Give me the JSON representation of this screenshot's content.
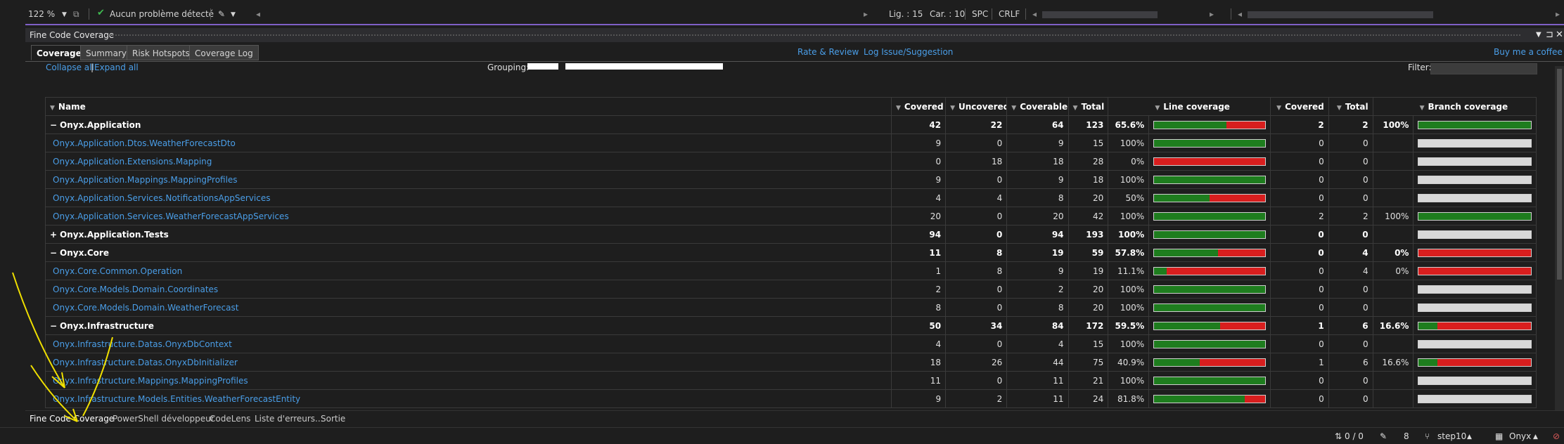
{
  "colors": {
    "accent": "#7f5fc6",
    "link": "#4a9ee8",
    "covered": "#1e7d1e",
    "uncovered": "#d81e1e",
    "no_branch": "#d8d8d8",
    "annotation": "#f0e000"
  },
  "editor_status": {
    "zoom": "122 %",
    "issues": "Aucun problème détecté",
    "line": "Lig. : 15",
    "column": "Car. : 10",
    "spacing": "SPC",
    "line_ending": "CRLF"
  },
  "panel": {
    "title": "Fine Code Coverage",
    "tabs": [
      "Coverage",
      "Summary",
      "Risk Hotspots",
      "Coverage Log"
    ],
    "links": {
      "rate": "Rate & Review",
      "issue": "Log Issue/Suggestion",
      "coffee": "Buy me a coffee"
    },
    "collapse_all": "Collapse all",
    "separator": "|",
    "expand_all": "Expand all",
    "grouping_label": "Grouping:",
    "filter_label": "Filter:"
  },
  "grid": {
    "headers": [
      "Name",
      "Covered",
      "Uncovered",
      "Coverable",
      "Total",
      "Line coverage",
      "Covered",
      "Total",
      "Branch coverage"
    ],
    "rows": [
      {
        "toggle": "−",
        "name": "Onyx.Application",
        "group": true,
        "covered": "42",
        "uncovered": "22",
        "coverable": "64",
        "total": "123",
        "pct": "65.6%",
        "line": 0.656,
        "bcovered": "2",
        "btotal": "2",
        "bpct": "100%",
        "branch": 1.0
      },
      {
        "name": "Onyx.Application.Dtos.WeatherForecastDto",
        "covered": "9",
        "uncovered": "0",
        "coverable": "9",
        "total": "15",
        "pct": "100%",
        "line": 1.0,
        "bcovered": "0",
        "btotal": "0",
        "bpct": "",
        "branch": null
      },
      {
        "name": "Onyx.Application.Extensions.Mapping",
        "covered": "0",
        "uncovered": "18",
        "coverable": "18",
        "total": "28",
        "pct": "0%",
        "line": 0.0,
        "bcovered": "0",
        "btotal": "0",
        "bpct": "",
        "branch": null
      },
      {
        "name": "Onyx.Application.Mappings.MappingProfiles",
        "covered": "9",
        "uncovered": "0",
        "coverable": "9",
        "total": "18",
        "pct": "100%",
        "line": 1.0,
        "bcovered": "0",
        "btotal": "0",
        "bpct": "",
        "branch": null
      },
      {
        "name": "Onyx.Application.Services.NotificationsAppServices",
        "covered": "4",
        "uncovered": "4",
        "coverable": "8",
        "total": "20",
        "pct": "50%",
        "line": 0.5,
        "bcovered": "0",
        "btotal": "0",
        "bpct": "",
        "branch": null
      },
      {
        "name": "Onyx.Application.Services.WeatherForecastAppServices",
        "covered": "20",
        "uncovered": "0",
        "coverable": "20",
        "total": "42",
        "pct": "100%",
        "line": 1.0,
        "bcovered": "2",
        "btotal": "2",
        "bpct": "100%",
        "branch": 1.0
      },
      {
        "toggle": "+",
        "name": "Onyx.Application.Tests",
        "group": true,
        "covered": "94",
        "uncovered": "0",
        "coverable": "94",
        "total": "193",
        "pct": "100%",
        "line": 1.0,
        "bcovered": "0",
        "btotal": "0",
        "bpct": "",
        "branch": null
      },
      {
        "toggle": "−",
        "name": "Onyx.Core",
        "group": true,
        "covered": "11",
        "uncovered": "8",
        "coverable": "19",
        "total": "59",
        "pct": "57.8%",
        "line": 0.578,
        "bcovered": "0",
        "btotal": "4",
        "bpct": "0%",
        "branch": 0.0
      },
      {
        "name": "Onyx.Core.Common.Operation",
        "covered": "1",
        "uncovered": "8",
        "coverable": "9",
        "total": "19",
        "pct": "11.1%",
        "line": 0.111,
        "bcovered": "0",
        "btotal": "4",
        "bpct": "0%",
        "branch": 0.0
      },
      {
        "name": "Onyx.Core.Models.Domain.Coordinates",
        "covered": "2",
        "uncovered": "0",
        "coverable": "2",
        "total": "20",
        "pct": "100%",
        "line": 1.0,
        "bcovered": "0",
        "btotal": "0",
        "bpct": "",
        "branch": null
      },
      {
        "name": "Onyx.Core.Models.Domain.WeatherForecast",
        "covered": "8",
        "uncovered": "0",
        "coverable": "8",
        "total": "20",
        "pct": "100%",
        "line": 1.0,
        "bcovered": "0",
        "btotal": "0",
        "bpct": "",
        "branch": null
      },
      {
        "toggle": "−",
        "name": "Onyx.Infrastructure",
        "group": true,
        "covered": "50",
        "uncovered": "34",
        "coverable": "84",
        "total": "172",
        "pct": "59.5%",
        "line": 0.595,
        "bcovered": "1",
        "btotal": "6",
        "bpct": "16.6%",
        "branch": 0.166
      },
      {
        "name": "Onyx.Infrastructure.Datas.OnyxDbContext",
        "covered": "4",
        "uncovered": "0",
        "coverable": "4",
        "total": "15",
        "pct": "100%",
        "line": 1.0,
        "bcovered": "0",
        "btotal": "0",
        "bpct": "",
        "branch": null
      },
      {
        "name": "Onyx.Infrastructure.Datas.OnyxDbInitializer",
        "covered": "18",
        "uncovered": "26",
        "coverable": "44",
        "total": "75",
        "pct": "40.9%",
        "line": 0.409,
        "bcovered": "1",
        "btotal": "6",
        "bpct": "16.6%",
        "branch": 0.166
      },
      {
        "name": "Onyx.Infrastructure.Mappings.MappingProfiles",
        "covered": "11",
        "uncovered": "0",
        "coverable": "11",
        "total": "21",
        "pct": "100%",
        "line": 1.0,
        "bcovered": "0",
        "btotal": "0",
        "bpct": "",
        "branch": null
      },
      {
        "name": "Onyx.Infrastructure.Models.Entities.WeatherForecastEntity",
        "covered": "9",
        "uncovered": "2",
        "coverable": "11",
        "total": "24",
        "pct": "81.8%",
        "line": 0.818,
        "bcovered": "0",
        "btotal": "0",
        "bpct": "",
        "branch": null
      }
    ]
  },
  "bottom_tabs": [
    "Fine Code Coverage",
    "PowerShell développeur",
    "CodeLens",
    "Liste d'erreurs...",
    "Sortie"
  ],
  "status": {
    "changes": "0 / 0",
    "commits": "8",
    "branch": "step10",
    "repo": "Onyx"
  }
}
